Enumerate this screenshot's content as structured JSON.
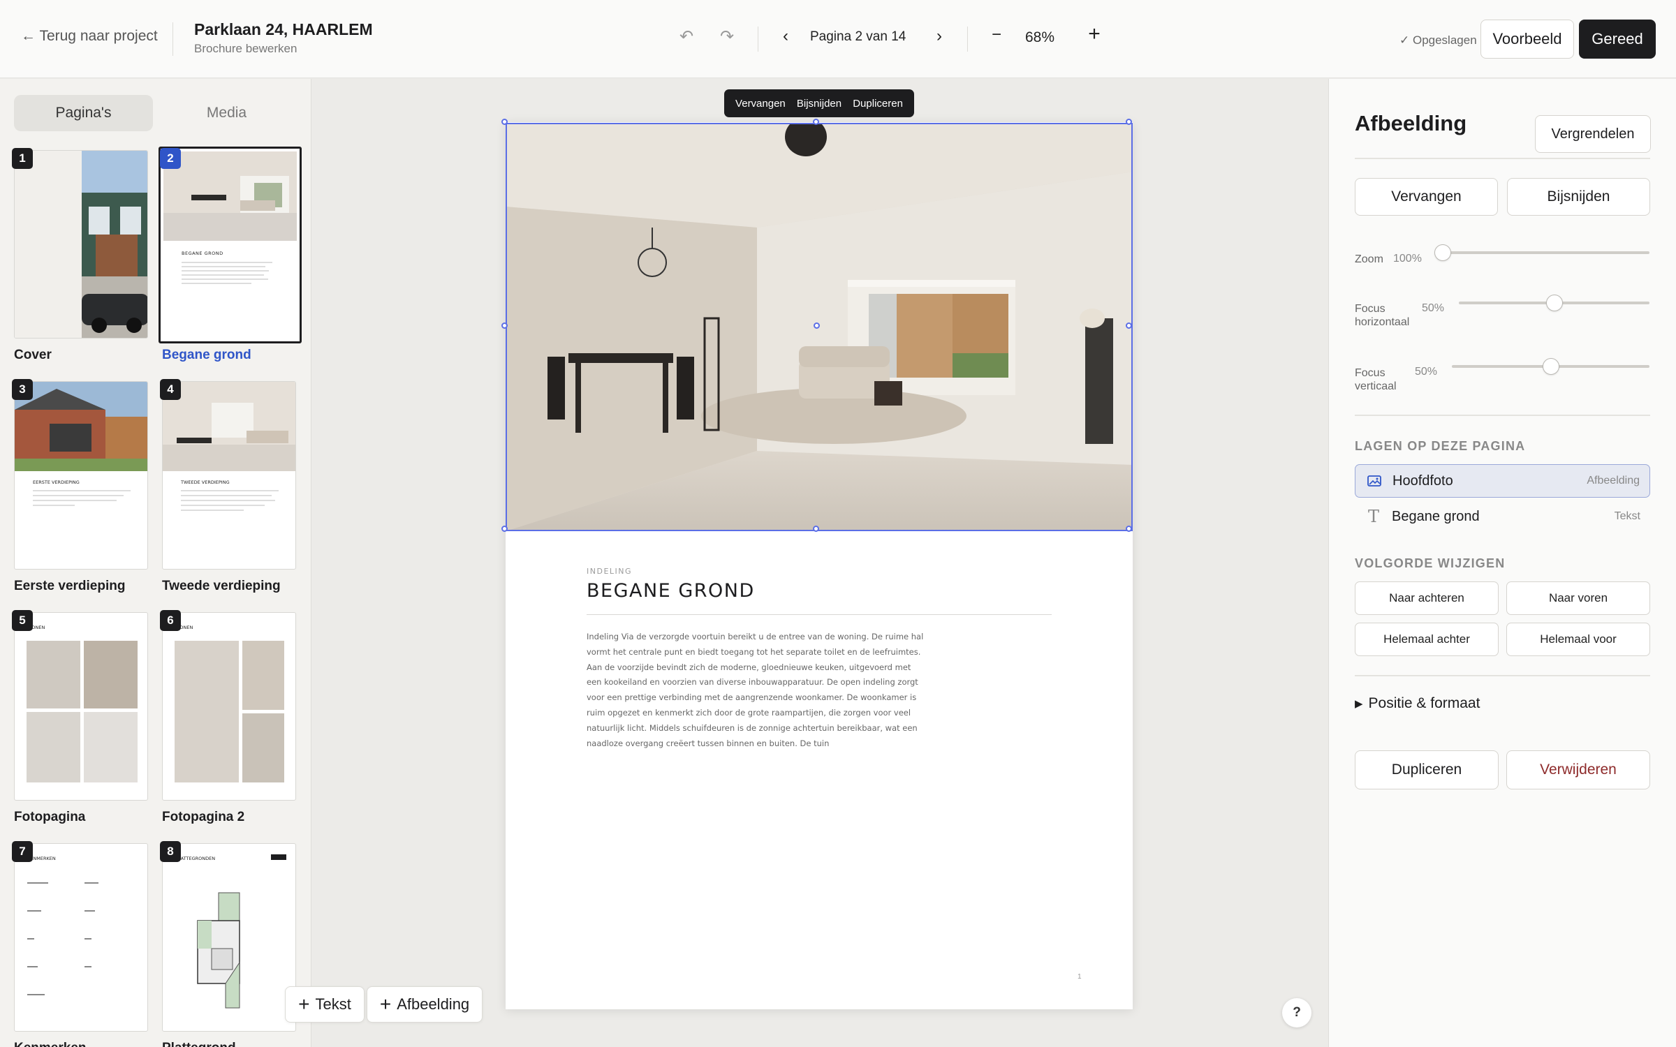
{
  "header": {
    "back_label": "← Terug naar project",
    "project_title": "Parklaan 24, HAARLEM",
    "project_subtitle": "Brochure bewerken",
    "page_indicator": "Pagina 2 van 14",
    "zoom_value": "68%",
    "saved_status": "✓ Opgeslagen",
    "preview_label": "Voorbeeld",
    "done_label": "Gereed"
  },
  "sidebar": {
    "tabs": [
      "Pagina's",
      "Media"
    ],
    "active_tab": "Pagina's",
    "pages": [
      {
        "number": "1",
        "label": "Cover"
      },
      {
        "number": "2",
        "label": "Begane grond"
      },
      {
        "number": "3",
        "label": "Eerste verdieping"
      },
      {
        "number": "4",
        "label": "Tweede verdieping"
      },
      {
        "number": "5",
        "label": "Fotopagina"
      },
      {
        "number": "6",
        "label": "Fotopagina 2"
      },
      {
        "number": "7",
        "label": "Kenmerken"
      },
      {
        "number": "8",
        "label": "Plattegrond"
      }
    ],
    "selected_page": "2",
    "thumb_text": {
      "p2_heading": "BEGANE GROND",
      "p3_heading": "EERSTE VERDIEPING",
      "p4_heading": "TWEEDE VERDIEPING",
      "p5_heading": "WONEN",
      "p6_heading": "WONEN",
      "p7_heading": "KENMERKEN",
      "p8_heading": "PLATTEGRONDEN"
    }
  },
  "canvas": {
    "floating_toolbar": [
      "Vervangen",
      "Bijsnijden",
      "Dupliceren"
    ],
    "document": {
      "kicker": "INDELING",
      "title": "BEGANE GROND",
      "body": "Indeling Via de verzorgde voortuin bereikt u de entree van de woning. De ruime hal vormt het centrale punt en biedt toegang tot het separate toilet en de leefruimtes. Aan de voorzijde bevindt zich de moderne, gloednieuwe keuken, uitgevoerd met een kookeiland en voorzien van diverse inbouwapparatuur. De open indeling zorgt voor een prettige verbinding met de aangrenzende woonkamer. De woonkamer is ruim opgezet en kenmerkt zich door de grote raampartijen, die zorgen voor veel natuurlijk licht. Middels schuifdeuren is de zonnige achtertuin bereikbaar, wat een naadloze overgang creëert tussen binnen en buiten. De tuin",
      "page_number": "1"
    },
    "add_text_label": "Tekst",
    "add_image_label": "Afbeelding",
    "help_label": "?"
  },
  "inspector": {
    "title": "Afbeelding",
    "lock_label": "Vergrendelen",
    "replace_label": "Vervangen",
    "crop_label": "Bijsnijden",
    "zoom_label": "Zoom",
    "zoom_value": "100%",
    "zoom_level": 0,
    "focus_h_label_1": "Focus",
    "focus_h_label_2": "horizontaal",
    "focus_h_value": "50%",
    "focus_h_level": 0.5,
    "focus_v_label_1": "Focus",
    "focus_v_label_2": "verticaal",
    "focus_v_value": "50%",
    "focus_v_level": 0.5,
    "layers_heading": "LAGEN OP DEZE PAGINA",
    "layers": [
      {
        "name": "Hoofdfoto",
        "type": "Afbeelding",
        "icon": "image-icon"
      },
      {
        "name": "Begane grond",
        "type": "Tekst",
        "icon": "text-icon"
      }
    ],
    "order_heading": "VOLGORDE WIJZIGEN",
    "order_buttons": [
      "Naar achteren",
      "Naar voren",
      "Helemaal achter",
      "Helemaal voor"
    ],
    "position_label": "Positie & formaat",
    "duplicate_label": "Dupliceren",
    "delete_label": "Verwijderen",
    "delete_color": "#8e2b2b",
    "accent_color": "#2f55c8"
  }
}
